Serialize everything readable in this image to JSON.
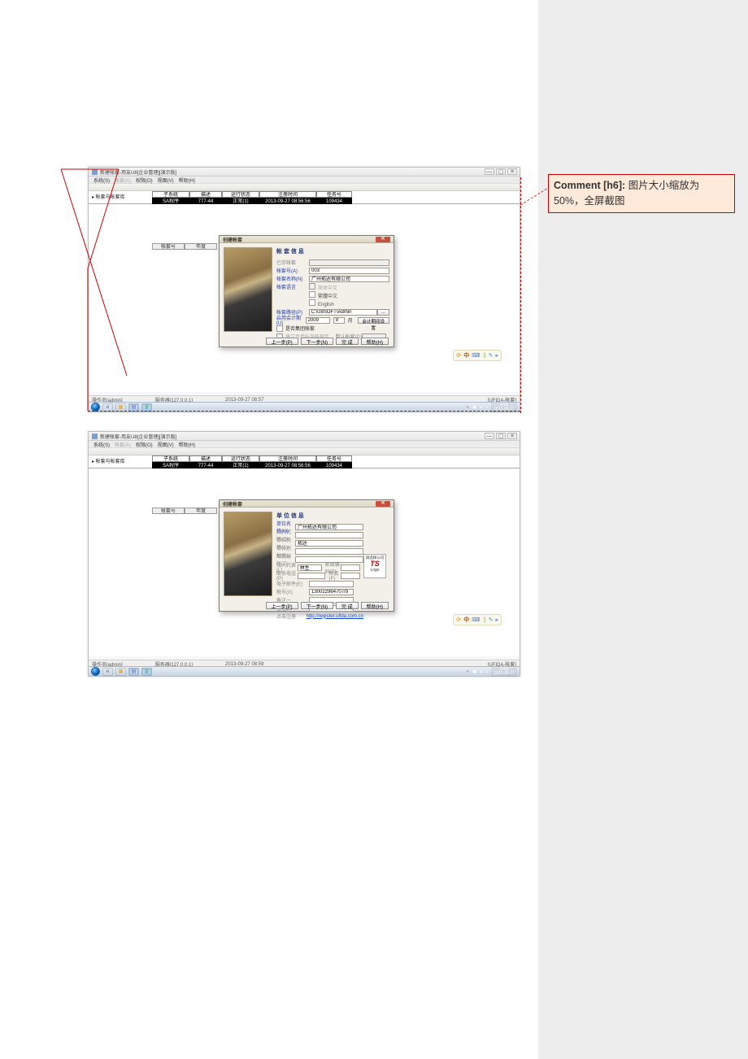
{
  "comment": {
    "tag": "Comment [h6]:",
    "text": "图片大小缩放为50%，全屏截图"
  },
  "shot1": {
    "title": "新建帐套-用友U8[企业管理][演示版]",
    "winbtns": {
      "min": "—",
      "max": "▢",
      "close": "✕"
    },
    "menus": [
      "系统(S)",
      "帐套(A)",
      "权限(O)",
      "视图(V)",
      "帮助(H)"
    ],
    "tree_label": "▸ 帐套与帐套库",
    "grid_header": [
      "子系统",
      "描述",
      "运行状态",
      "注册时间",
      "任务号"
    ],
    "grid_row": [
      "SA程序",
      "777-44",
      "正常(1)",
      "2013-09-27 08:56:56",
      "109434"
    ],
    "subgrid_header": [
      "帐套号",
      "年度"
    ],
    "wizard": {
      "title": "创建帐套",
      "heading": "帐 套 信 息",
      "fields": {
        "existing": "已存帐套",
        "acct_no": "帐套号(A)",
        "acct_no_val": "003",
        "acct_name": "帐套名称(N)",
        "acct_name_val": "广州拓达有限公司",
        "lang": "帐套语言",
        "lang_cn_simp": "简体中文",
        "lang_cn_trad": "繁體中文",
        "lang_en": "English",
        "path": "帐套路径(P)",
        "path_val": "C:\\U8SOFT\\Admin",
        "start_period": "启用会计期(U)",
        "year_val": "2009",
        "month_val": "9",
        "month_label": "月",
        "period_btn": "会计期间设置",
        "chk_demo": "是否集团帐套",
        "chk_test_data": "建立专用标准帐套库",
        "default_account": "默认帐套(D)"
      },
      "buttons": {
        "prev": "上一步(P)",
        "next": "下一步(N)",
        "finish": "完 成",
        "help": "帮助(H)"
      }
    },
    "tray_icons": [
      "⟳",
      "中",
      "⌨",
      ":)",
      "✎",
      "▸"
    ],
    "status": {
      "left": "操作员[admin]",
      "mid1": "服务器[127.0.0.1]",
      "mid2": "2013-09-27 08:57",
      "right": "[UFIDA-帐套]"
    },
    "taskbar": {
      "tray_items": [
        "◐",
        "▣",
        "▴",
        "♪"
      ],
      "time": "8:58",
      "date": "2013-09-27"
    }
  },
  "shot2": {
    "title": "新建帐套-用友U8[企业管理][演示版]",
    "winbtns": {
      "min": "—",
      "max": "▢",
      "close": "✕"
    },
    "menus": [
      "系统(S)",
      "帐套(A)",
      "权限(O)",
      "视图(V)",
      "帮助(H)"
    ],
    "tree_label": "▸ 帐套与帐套库",
    "grid_header": [
      "子系统",
      "描述",
      "运行状态",
      "注册时间",
      "任务号"
    ],
    "grid_row": [
      "SA程序",
      "777-44",
      "正常(1)",
      "2013-09-27 08:56:56",
      "109434"
    ],
    "subgrid_header": [
      "帐套号",
      "年度"
    ],
    "wizard": {
      "title": "创建帐套",
      "heading": "单 位 信 息",
      "fields": {
        "company": "单位名称(M)",
        "company_val": "广州拓达有限公司",
        "org_code": "机构代码(O)",
        "short": "单位简称(A)",
        "short_val": "拓达",
        "addr": "单位地址(R)",
        "zip": "邮政编码(Z)",
        "legal": "法人代表(L)",
        "legal_val": "林生",
        "zip2": "邮政编码(Z)",
        "phone": "联系电话(P)",
        "fax": "传真(F)",
        "email": "电子邮件(E)",
        "tax": "税号(X)",
        "tax_val": "130022964707/9",
        "bak1": "备注一",
        "bak2": "备注二",
        "reg": "点击注册"
      },
      "logo_hint": "请选择公司",
      "logo_text": "Logo",
      "logo_mark": "TS",
      "link": "http://register.ufida.com.cn",
      "buttons": {
        "prev": "上一步(P)",
        "next": "下一步(N)",
        "finish": "完 成",
        "help": "帮助(H)"
      }
    },
    "tray_icons": [
      "⟳",
      "中",
      "⌨",
      ":)",
      "✎",
      "▸"
    ],
    "status": {
      "left": "操作员[admin]",
      "mid1": "服务器[127.0.0.1]",
      "mid2": "2013-09-27 08:59",
      "right": "[UFIDA-帐套]"
    },
    "taskbar": {
      "tray_items": [
        "◐",
        "▣",
        "▴",
        "♪"
      ],
      "time": "8:59",
      "date": "2013-09-27"
    }
  }
}
